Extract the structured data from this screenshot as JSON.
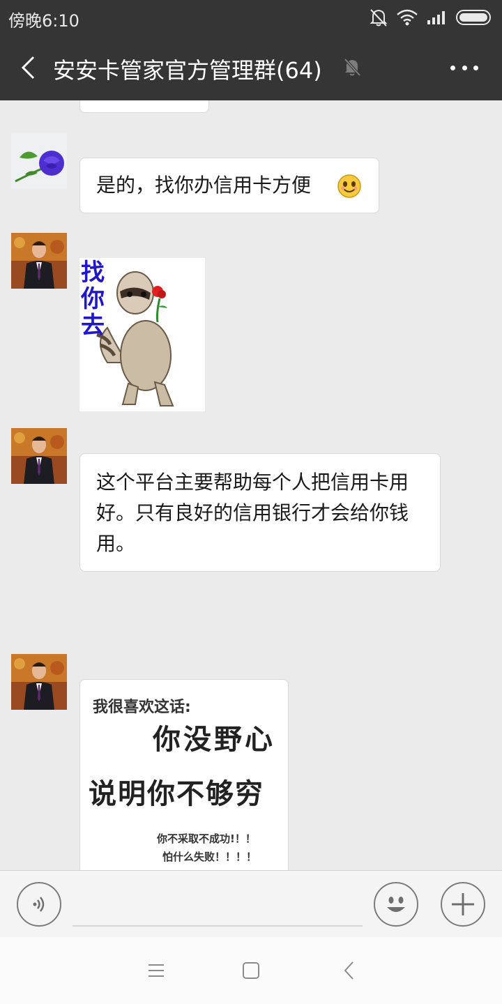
{
  "status": {
    "time": "傍晚6:10"
  },
  "header": {
    "title": "安安卡管家官方管理群(64)"
  },
  "messages": [
    {
      "text": "是的，找你办信用卡方便"
    },
    {
      "sticker_text": "找你去"
    },
    {
      "text": "这个平台主要帮助每个人把信用卡用好。只有良好的信用银行才会给你钱用。"
    },
    {
      "image_text": {
        "line1": "我很喜欢这话:",
        "line2": "你没野心",
        "line3": "说明你不够穷",
        "line4": "你不采取不成功!！！",
        "line5": "怕什么失败！！！！"
      }
    }
  ],
  "colors": {
    "header_bg": "#353535",
    "chat_bg": "#ebebeb",
    "bubble_bg": "#ffffff",
    "sticker_text": "#1f17c9"
  }
}
